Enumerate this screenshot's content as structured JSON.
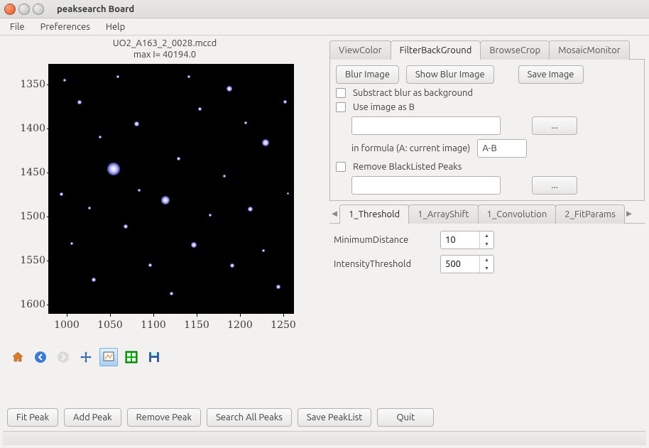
{
  "window": {
    "title": "peaksearch Board"
  },
  "menu": {
    "file": "File",
    "prefs": "Preferences",
    "help": "Help"
  },
  "plot": {
    "title_line1": "UO2_A163_2_0028.mccd",
    "title_line2": "max I= 40194.0",
    "yticks": [
      "1350",
      "1400",
      "1450",
      "1500",
      "1550",
      "1600"
    ],
    "xticks": [
      "1000",
      "1050",
      "1100",
      "1150",
      "1200",
      "1250"
    ]
  },
  "toolbar_icons": {
    "home": "home-icon",
    "back": "back-icon",
    "forward": "forward-icon",
    "pan": "pan-icon",
    "zoom": "zoom-icon",
    "subplots": "subplots-icon",
    "save": "save-icon"
  },
  "right": {
    "main_tabs": {
      "view": "ViewColor",
      "filter": "FilterBackGround",
      "browse": "BrowseCrop",
      "mosaic": "MosaicMonitor"
    },
    "filter": {
      "blur_btn": "Blur Image",
      "show_blur_btn": "Show Blur Image",
      "save_btn": "Save Image",
      "substract": "Substract blur as background",
      "use_b": "Use image as B",
      "use_b_path": "",
      "browse1": "...",
      "formula_label": "in formula (A: current image)",
      "formula_value": "A-B",
      "remove_bl": "Remove BlackListed Peaks",
      "bl_path": "",
      "browse2": "..."
    },
    "sub_tabs": {
      "t1": "1_Threshold",
      "t2": "1_ArrayShift",
      "t3": "1_Convolution",
      "t4": "2_FitParams"
    },
    "threshold": {
      "min_dist_label": "MinimumDistance",
      "min_dist_value": "10",
      "intensity_label": "IntensityThreshold",
      "intensity_value": "500"
    }
  },
  "bottom": {
    "fit": "Fit Peak",
    "add": "Add Peak",
    "remove": "Remove Peak",
    "search": "Search All Peaks",
    "savepl": "Save PeakList",
    "quit": "Quit"
  }
}
